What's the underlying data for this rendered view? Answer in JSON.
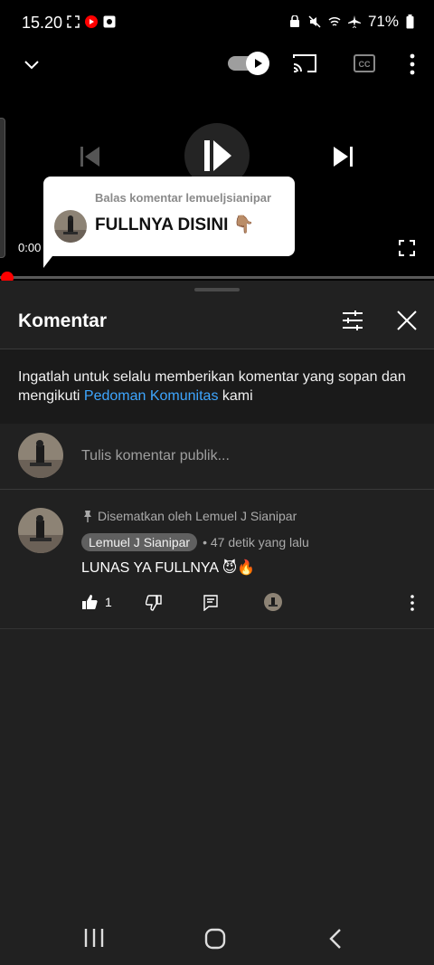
{
  "status_bar": {
    "time": "15.20",
    "battery": "71%"
  },
  "player": {
    "current_time": "0:00",
    "progress_fraction": 0.0,
    "autoplay_on": true,
    "icons": [
      "chevron-down-icon",
      "autoplay-toggle",
      "cast-icon",
      "captions-icon",
      "more-vert-icon",
      "previous-icon",
      "play-icon",
      "next-icon",
      "fullscreen-icon"
    ]
  },
  "reply_bubble": {
    "subtitle": "Balas komentar lemueljsianipar",
    "title": "FULLNYA DISINI 👇🏽"
  },
  "comments_panel": {
    "title": "Komentar",
    "guideline_prefix": "Ingatlah untuk selalu memberikan komentar yang sopan dan mengikuti ",
    "guideline_link": "Pedoman Komunitas",
    "guideline_suffix": " kami",
    "compose_placeholder": "Tulis komentar publik...",
    "comments": [
      {
        "pinned_label": "Disematkan oleh Lemuel J Sianipar",
        "author": "Lemuel J Sianipar",
        "time_ago": "• 47 detik yang lalu",
        "text": "LUNAS YA FULLNYA 😈🔥",
        "likes": "1"
      }
    ]
  },
  "colors": {
    "accent_link": "#3ea6ff",
    "progress_red": "#ff0000",
    "sheet_bg": "#212121"
  }
}
